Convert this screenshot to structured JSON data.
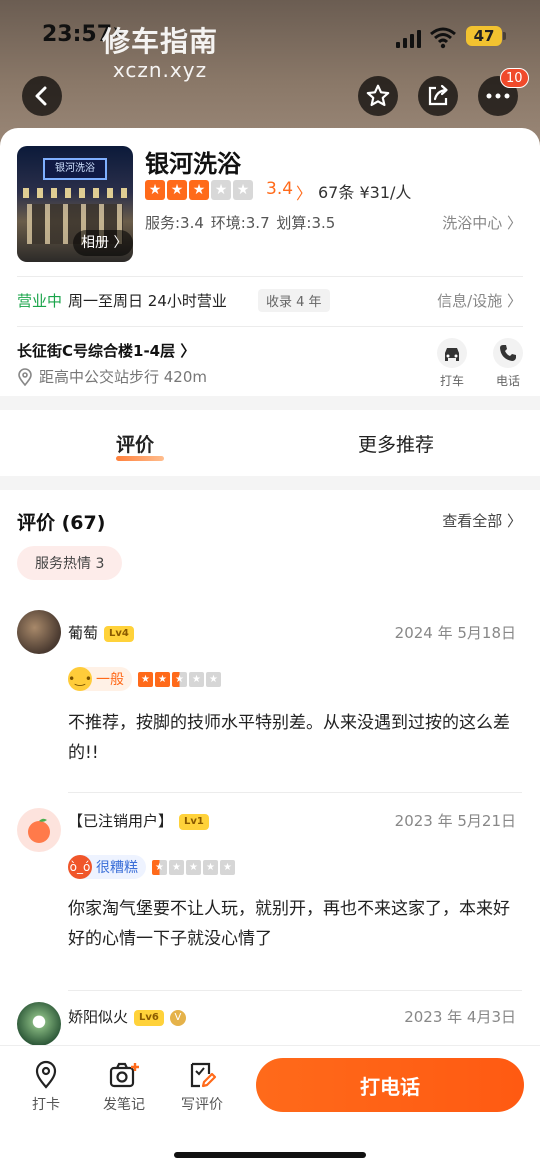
{
  "status": {
    "time": "23:57",
    "battery": "47"
  },
  "watermark": {
    "line1": "修车指南",
    "line2": "xczn.xyz"
  },
  "topbar": {
    "notification_count": "10"
  },
  "shop": {
    "name": "银河洗浴",
    "photo_sign": "银河洗浴",
    "album_label": "相册 〉",
    "rating": "3.4",
    "rating_stars": 3,
    "review_count": "67条",
    "price": "¥31/人",
    "service": "服务:3.4",
    "environment": "环境:3.7",
    "value": "划算:3.5",
    "category": "洗浴中心 〉",
    "open_status": "营业中",
    "hours": "周一至周日 24小时营业",
    "listed_tag": "收录 4 年",
    "info_link": "信息/设施 〉",
    "address": "长征街C号综合楼1-4层 〉",
    "distance": "距高中公交站步行 420m"
  },
  "actions": {
    "taxi": "打车",
    "phone": "电话"
  },
  "tabs": [
    {
      "label": "评价"
    },
    {
      "label": "更多推荐"
    }
  ],
  "reviews": {
    "title": "评价 (67)",
    "view_all": "查看全部 〉",
    "chip": "服务热情 3",
    "items": [
      {
        "user": "葡萄",
        "level": "Lv4",
        "date": "2024 年 5月18日",
        "mood": "一般",
        "stars": 2.5,
        "text": "不推荐，按脚的技师水平特别差。从来没遇到过按的这么差的!!"
      },
      {
        "user": "【已注销用户】",
        "level": "Lv1",
        "date": "2023 年 5月21日",
        "mood": "很糟糕",
        "stars": 0.5,
        "text": "你家淘气堡要不让人玩，就别开，再也不来这家了，本来好好的心情一下子就没心情了"
      },
      {
        "user": "娇阳似火",
        "level": "Lv6",
        "date": "2023 年 4月3日",
        "mood": "",
        "stars": 0,
        "text": ""
      }
    ]
  },
  "bottom_bar": {
    "checkin": "打卡",
    "post_note": "发笔记",
    "write_review": "写评价",
    "call": "打电话"
  },
  "colors": {
    "accent": "#ff6a1a",
    "open_green": "#1aa44a",
    "badge_red": "#f04a2b"
  }
}
